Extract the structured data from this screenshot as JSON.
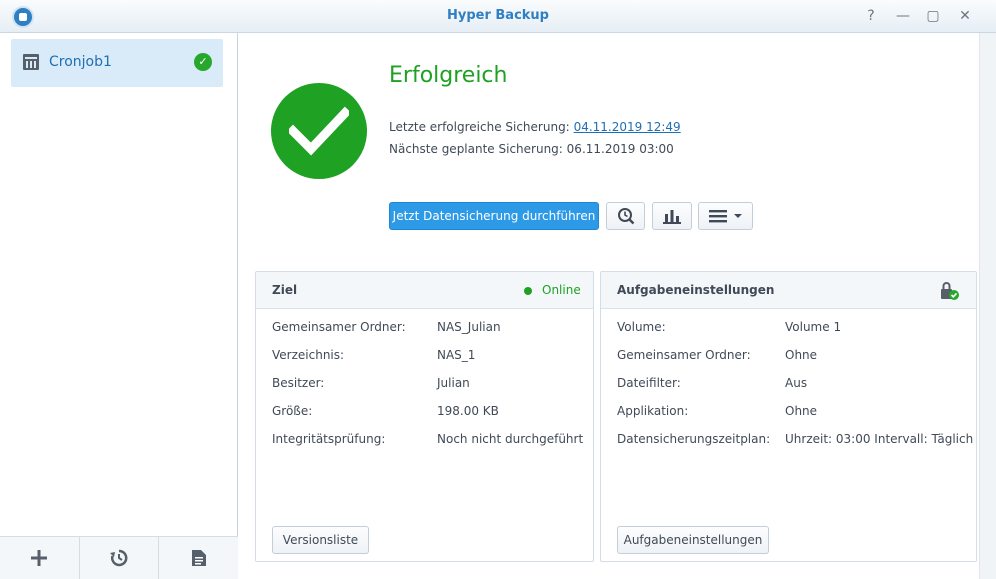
{
  "window": {
    "title": "Hyper Backup",
    "help_icon": "question-icon",
    "minimize_icon": "minimize-icon",
    "maximize_icon": "maximize-icon",
    "close_icon": "close-icon"
  },
  "sidebar": {
    "jobs": [
      {
        "label": "Cronjob1",
        "icon": "nas-task-icon",
        "status_icon": "success-check-icon"
      }
    ],
    "footer": {
      "add_icon": "plus-icon",
      "restore_icon": "history-icon",
      "log_icon": "document-icon"
    }
  },
  "status": {
    "title": "Erfolgreich",
    "last_backup_label": "Letzte erfolgreiche Sicherung:",
    "last_backup_value": "04.11.2019 12:49",
    "next_backup_label": "Nächste geplante Sicherung:",
    "next_backup_value": "06.11.2019 03:00"
  },
  "actions": {
    "backup_now": "Jetzt Datensicherung durchführen",
    "version_icon": "clock-search-icon",
    "stats_icon": "bar-chart-icon",
    "menu_icon": "menu-icon"
  },
  "target_panel": {
    "title": "Ziel",
    "status": "Online",
    "rows": [
      {
        "label": "Gemeinsamer Ordner:",
        "value": "NAS_Julian"
      },
      {
        "label": "Verzeichnis:",
        "value": "NAS_1"
      },
      {
        "label": "Besitzer:",
        "value": "Julian"
      },
      {
        "label": "Größe:",
        "value": "198.00 KB"
      },
      {
        "label": "Integritätsprüfung:",
        "value": "Noch nicht durchgeführt"
      }
    ],
    "button": "Versionsliste"
  },
  "task_panel": {
    "title": "Aufgabeneinstellungen",
    "lock_icon": "lock-check-icon",
    "rows": [
      {
        "label": "Volume:",
        "value": "Volume 1"
      },
      {
        "label": "Gemeinsamer Ordner:",
        "value": "Ohne"
      },
      {
        "label": "Dateifilter:",
        "value": "Aus"
      },
      {
        "label": "Applikation:",
        "value": "Ohne"
      },
      {
        "label": "Datensicherungszeitplan:",
        "value": "Uhrzeit: 03:00 Intervall: Täglich"
      }
    ],
    "button": "Aufgabeneinstellungen"
  },
  "colors": {
    "accent": "#2d9ae8",
    "success": "#1fa123",
    "title": "#2f7fc3"
  }
}
